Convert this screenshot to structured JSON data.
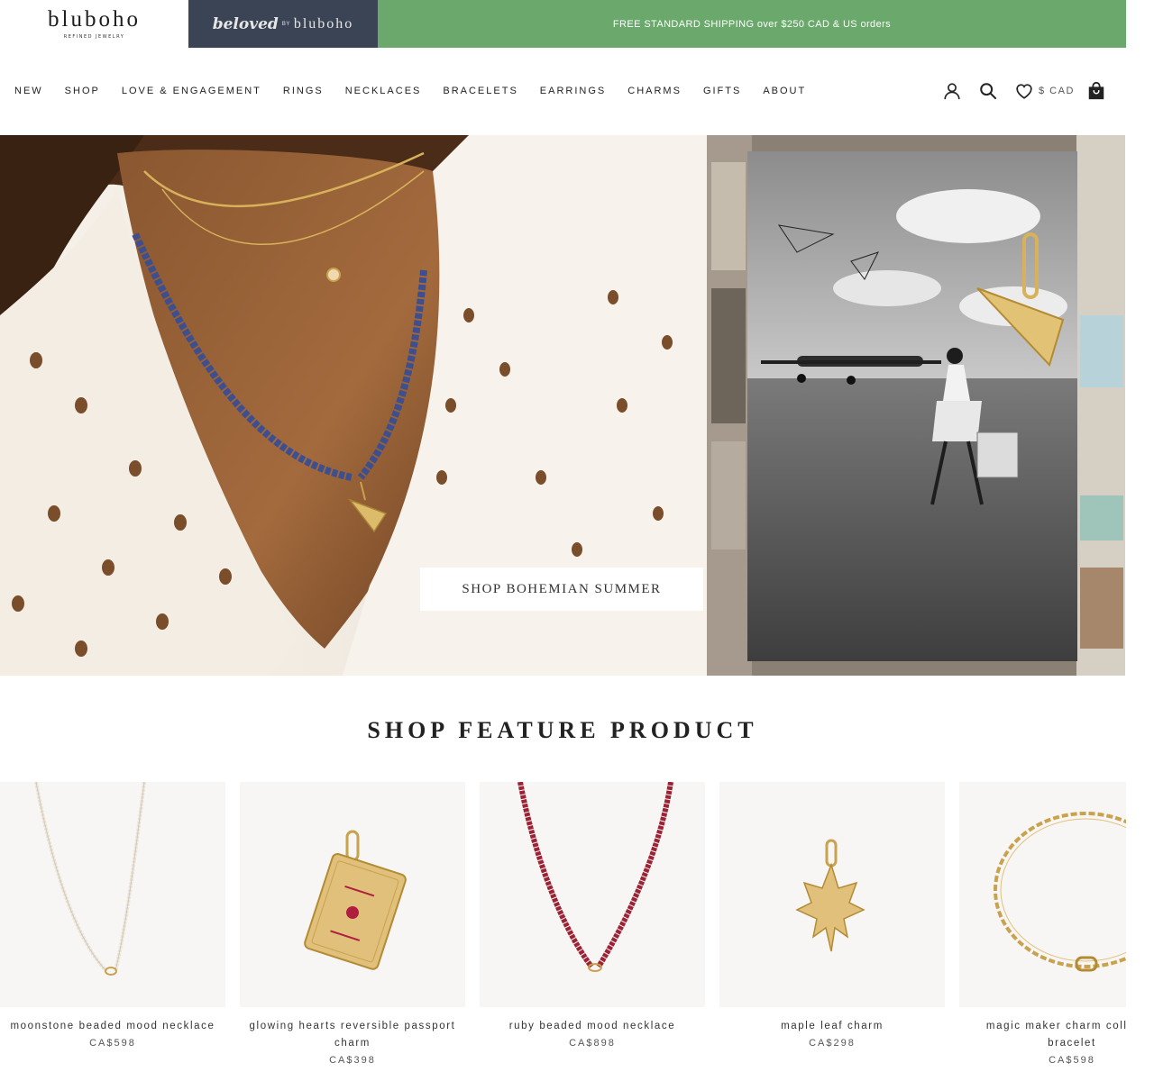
{
  "brand": {
    "name": "bluboho",
    "tagline": "REFINED JEWELRY"
  },
  "beloved": {
    "script": "beloved",
    "by": "BY",
    "brand": "bluboho"
  },
  "announcement": "FREE STANDARD SHIPPING over $250 CAD & US orders",
  "nav": {
    "items": [
      "NEW",
      "SHOP",
      "LOVE & ENGAGEMENT",
      "RINGS",
      "NECKLACES",
      "BRACELETS",
      "EARRINGS",
      "CHARMS",
      "GIFTS",
      "ABOUT"
    ]
  },
  "utilities": {
    "currency": "$ CAD",
    "icons": [
      "account-icon",
      "search-icon",
      "wishlist-heart-icon",
      "shopping-bag-icon"
    ]
  },
  "hero": {
    "cta_label": "SHOP BOHEMIAN SUMMER"
  },
  "feature": {
    "title": "SHOP FEATURE PRODUCT",
    "products": [
      {
        "name": "moonstone beaded mood necklace",
        "price": "CA$598"
      },
      {
        "name": "glowing hearts reversible passport charm",
        "price": "CA$398"
      },
      {
        "name": "ruby beaded mood necklace",
        "price": "CA$898"
      },
      {
        "name": "maple leaf charm",
        "price": "CA$298"
      },
      {
        "name": "magic maker charm collector bracelet",
        "price": "CA$598"
      }
    ]
  },
  "colors": {
    "announcement_bg": "#6aa86b",
    "beloved_bg": "#3b4455",
    "gold": "#c9a24d",
    "ruby": "#9b2335"
  }
}
